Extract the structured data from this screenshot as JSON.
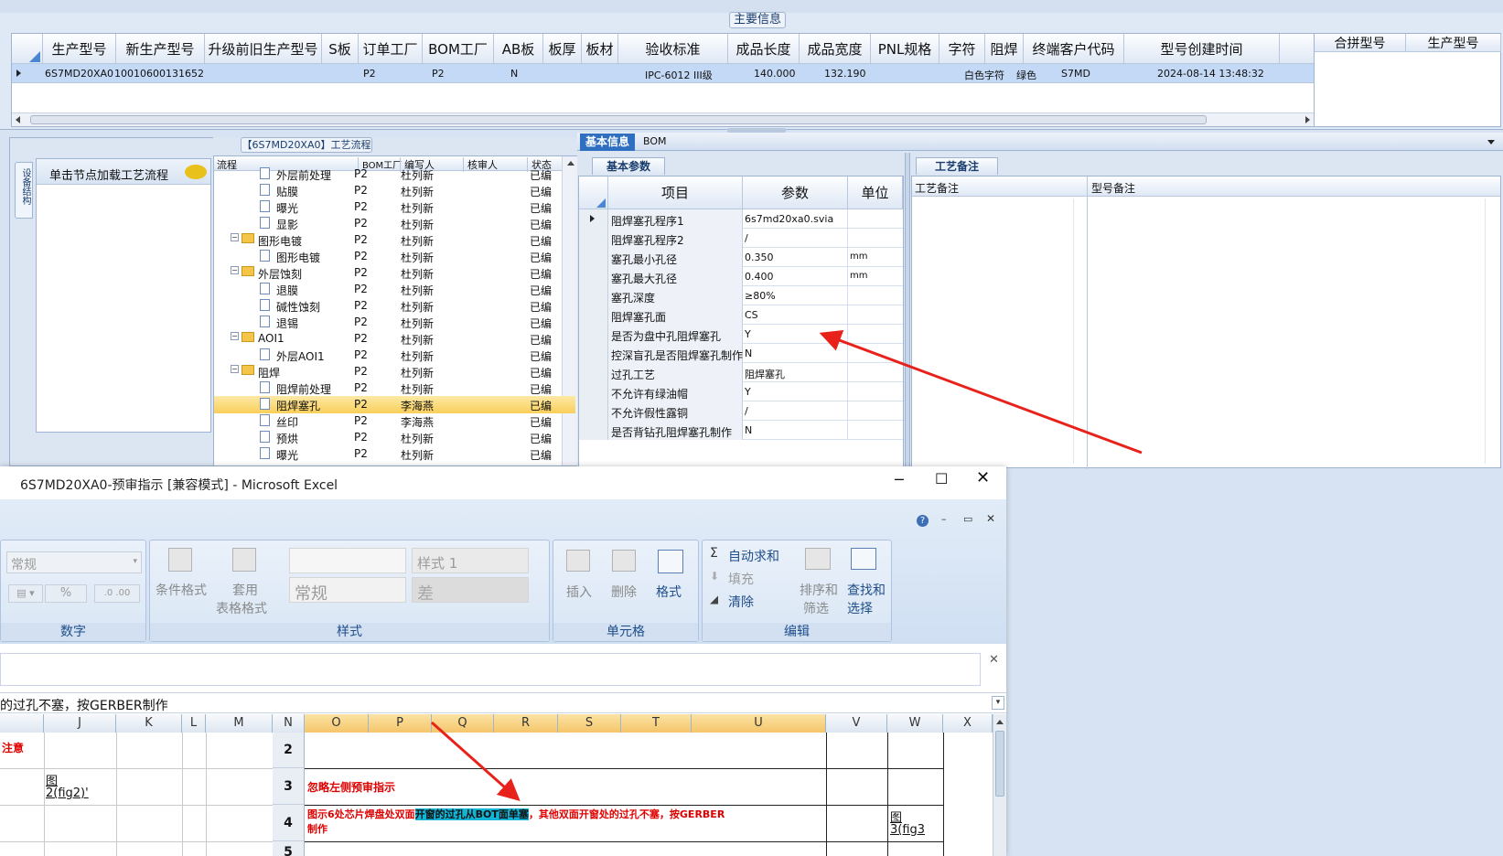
{
  "main_info": {
    "section_title": "主要信息",
    "columns": [
      "生产型号",
      "新生产型号",
      "升级前旧生产型号",
      "S板",
      "订单工厂",
      "BOM工厂",
      "AB板",
      "板厚",
      "板材",
      "验收标准",
      "成品长度",
      "成品宽度",
      "PNL规格",
      "字符",
      "阻焊",
      "终端客户代码",
      "型号创建时间"
    ],
    "row": {
      "model": "6S7MD20XA0",
      "new_model": "10010600131652",
      "order_factory": "P2",
      "bom_factory": "P2",
      "ab": "N",
      "standard": "IPC-6012 III级",
      "length": "140.000",
      "width": "132.190",
      "char": "白色字符",
      "mask": "绿色",
      "customer": "S7MD",
      "created": "2024-08-14 13:48:32"
    },
    "merge_columns": [
      "合拼型号",
      "生产型号"
    ]
  },
  "side_panel": {
    "vertical_tab": "设备结构",
    "hint": "单击节点加载工艺流程"
  },
  "flow": {
    "title": "【6S7MD20XA0】工艺流程",
    "columns": [
      "流程",
      "BOM工厂",
      "编写人",
      "核审人",
      "状态"
    ],
    "rows": [
      {
        "name": "外层前处理",
        "indent": 2,
        "folder": false,
        "factory": "P2",
        "writer": "杜列新",
        "status": "已编"
      },
      {
        "name": "贴膜",
        "indent": 2,
        "folder": false,
        "factory": "P2",
        "writer": "杜列新",
        "status": "已编"
      },
      {
        "name": "曝光",
        "indent": 2,
        "folder": false,
        "factory": "P2",
        "writer": "杜列新",
        "status": "已编"
      },
      {
        "name": "显影",
        "indent": 2,
        "folder": false,
        "factory": "P2",
        "writer": "杜列新",
        "status": "已编"
      },
      {
        "name": "图形电镀",
        "indent": 1,
        "folder": true,
        "factory": "P2",
        "writer": "杜列新",
        "status": "已编"
      },
      {
        "name": "图形电镀",
        "indent": 2,
        "folder": false,
        "factory": "P2",
        "writer": "杜列新",
        "status": "已编"
      },
      {
        "name": "外层蚀刻",
        "indent": 1,
        "folder": true,
        "factory": "P2",
        "writer": "杜列新",
        "status": "已编"
      },
      {
        "name": "退膜",
        "indent": 2,
        "folder": false,
        "factory": "P2",
        "writer": "杜列新",
        "status": "已编"
      },
      {
        "name": "碱性蚀刻",
        "indent": 2,
        "folder": false,
        "factory": "P2",
        "writer": "杜列新",
        "status": "已编"
      },
      {
        "name": "退锡",
        "indent": 2,
        "folder": false,
        "factory": "P2",
        "writer": "杜列新",
        "status": "已编"
      },
      {
        "name": "AOI1",
        "indent": 1,
        "folder": true,
        "factory": "P2",
        "writer": "杜列新",
        "status": "已编"
      },
      {
        "name": "外层AOI1",
        "indent": 2,
        "folder": false,
        "factory": "P2",
        "writer": "杜列新",
        "status": "已编"
      },
      {
        "name": "阻焊",
        "indent": 1,
        "folder": true,
        "factory": "P2",
        "writer": "杜列新",
        "status": "已编"
      },
      {
        "name": "阻焊前处理",
        "indent": 2,
        "folder": false,
        "factory": "P2",
        "writer": "杜列新",
        "status": "已编"
      },
      {
        "name": "阻焊塞孔",
        "indent": 2,
        "folder": false,
        "factory": "P2",
        "writer": "李海燕",
        "status": "已编",
        "selected": true
      },
      {
        "name": "丝印",
        "indent": 2,
        "folder": false,
        "factory": "P2",
        "writer": "李海燕",
        "status": "已编"
      },
      {
        "name": "预烘",
        "indent": 2,
        "folder": false,
        "factory": "P2",
        "writer": "杜列新",
        "status": "已编"
      },
      {
        "name": "曝光",
        "indent": 2,
        "folder": false,
        "factory": "P2",
        "writer": "杜列新",
        "status": "已编"
      }
    ]
  },
  "basic": {
    "tabs": [
      "基本信息",
      "BOM"
    ],
    "subtab": "基本参数",
    "columns": [
      "项目",
      "参数",
      "单位"
    ],
    "rows": [
      {
        "item": "阻焊塞孔程序1",
        "value": "6s7md20xa0.svia",
        "unit": ""
      },
      {
        "item": "阻焊塞孔程序2",
        "value": "/",
        "unit": ""
      },
      {
        "item": "塞孔最小孔径",
        "value": "0.350",
        "unit": "mm"
      },
      {
        "item": "塞孔最大孔径",
        "value": "0.400",
        "unit": "mm"
      },
      {
        "item": "塞孔深度",
        "value": "≥80%",
        "unit": ""
      },
      {
        "item": "阻焊塞孔面",
        "value": "CS",
        "unit": ""
      },
      {
        "item": "是否为盘中孔阻焊塞孔",
        "value": "Y",
        "unit": ""
      },
      {
        "item": "控深盲孔是否阻焊塞孔制作",
        "value": "N",
        "unit": ""
      },
      {
        "item": "过孔工艺",
        "value": "阻焊塞孔",
        "unit": ""
      },
      {
        "item": "不允许有绿油帽",
        "value": "Y",
        "unit": ""
      },
      {
        "item": "不允许假性露铜",
        "value": "/",
        "unit": ""
      },
      {
        "item": "是否背钻孔阻焊塞孔制作",
        "value": "N",
        "unit": ""
      }
    ]
  },
  "remarks": {
    "tab": "工艺备注",
    "columns": [
      "工艺备注",
      "型号备注"
    ]
  },
  "excel": {
    "title": "6S7MD20XA0-预审指示  [兼容模式] - Microsoft Excel",
    "ribbon": {
      "number_format": "常规",
      "percent": "%",
      "cond_format": "条件格式",
      "table_format_1": "套用",
      "table_format_2": "表格格式",
      "style1": "样式 1",
      "style_normal": "常规",
      "style_bad": "差",
      "insert": "插入",
      "delete": "删除",
      "format": "格式",
      "autosum": "自动求和",
      "fill": "填充",
      "clear": "清除",
      "sort_1": "排序和",
      "sort_2": "筛选",
      "find_1": "查找和",
      "find_2": "选择",
      "group_number": "数字",
      "group_style": "样式",
      "group_cells": "单元格",
      "group_edit": "编辑"
    },
    "formula": "的过孔不塞，按GERBER制作",
    "columns": [
      "J",
      "K",
      "L",
      "M",
      "N",
      "O",
      "P",
      "Q",
      "R",
      "S",
      "T",
      "U",
      "V",
      "W",
      "X"
    ],
    "rows": {
      "r2": "2",
      "r3": "3",
      "r4": "4",
      "r5": "5"
    },
    "cells": {
      "i2": "注意",
      "j3a": "图",
      "j3b": "2(fig2)'",
      "o3": "忽略左侧预审指示",
      "o4_pre": "图示6处芯片焊盘处双面",
      "o4_hl": "开窗的过孔从BOT面单塞",
      "o4_post": "，其他双面开窗处的过孔不塞，按GERBER",
      "o4_line2": "制作",
      "w4a": "图",
      "w4b": "3(fig3"
    }
  },
  "colors": {
    "accent_red": "#e8221b",
    "selection_blue": "#c3d9f5",
    "tree_highlight": "#fbd76e",
    "tab_blue": "#2f6fc1"
  }
}
